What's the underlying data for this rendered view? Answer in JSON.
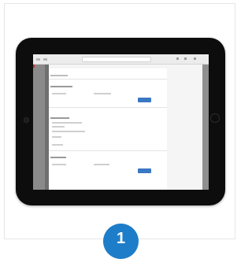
{
  "step": {
    "number": "1"
  },
  "tablet": {
    "browser": {
      "url": ""
    },
    "page": {
      "header": "",
      "section1": {
        "title": "",
        "field_label": "",
        "field_value": "",
        "button": ""
      },
      "section2": {
        "title": "",
        "items": [
          "",
          "",
          "",
          ""
        ]
      },
      "section3": {
        "title": "",
        "field_label": "",
        "field_value": "",
        "button": ""
      }
    }
  },
  "colors": {
    "badge": "#1e7dc8",
    "button": "#3a78c3",
    "tablet_frame": "#0d0d0d"
  }
}
